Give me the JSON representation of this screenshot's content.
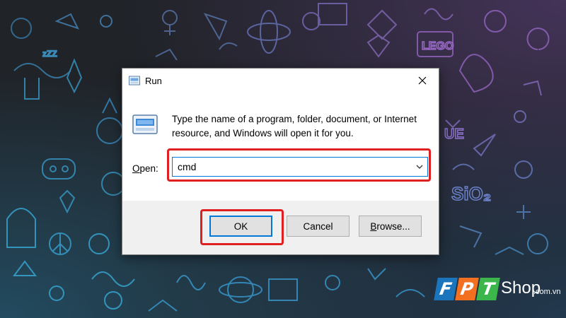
{
  "dialog": {
    "title": "Run",
    "description": "Type the name of a program, folder, document, or Internet resource, and Windows will open it for you.",
    "open_label": "Open:",
    "open_value": "cmd",
    "buttons": {
      "ok": "OK",
      "cancel": "Cancel",
      "browse": "Browse..."
    }
  },
  "brand": {
    "letters": [
      "F",
      "P",
      "T"
    ],
    "shop": "Shop",
    "domain": ".com.vn",
    "colors": {
      "blue": "#1b75bc",
      "orange": "#f37021",
      "green": "#3cb54a"
    }
  },
  "wallpaper": {
    "text_doodles": [
      "SiO2",
      "UE",
      "LEGO",
      "zZZ"
    ]
  },
  "colors": {
    "highlight": "#e02020",
    "focus_blue": "#0078d7",
    "footer_bg": "#f0f0f0"
  }
}
